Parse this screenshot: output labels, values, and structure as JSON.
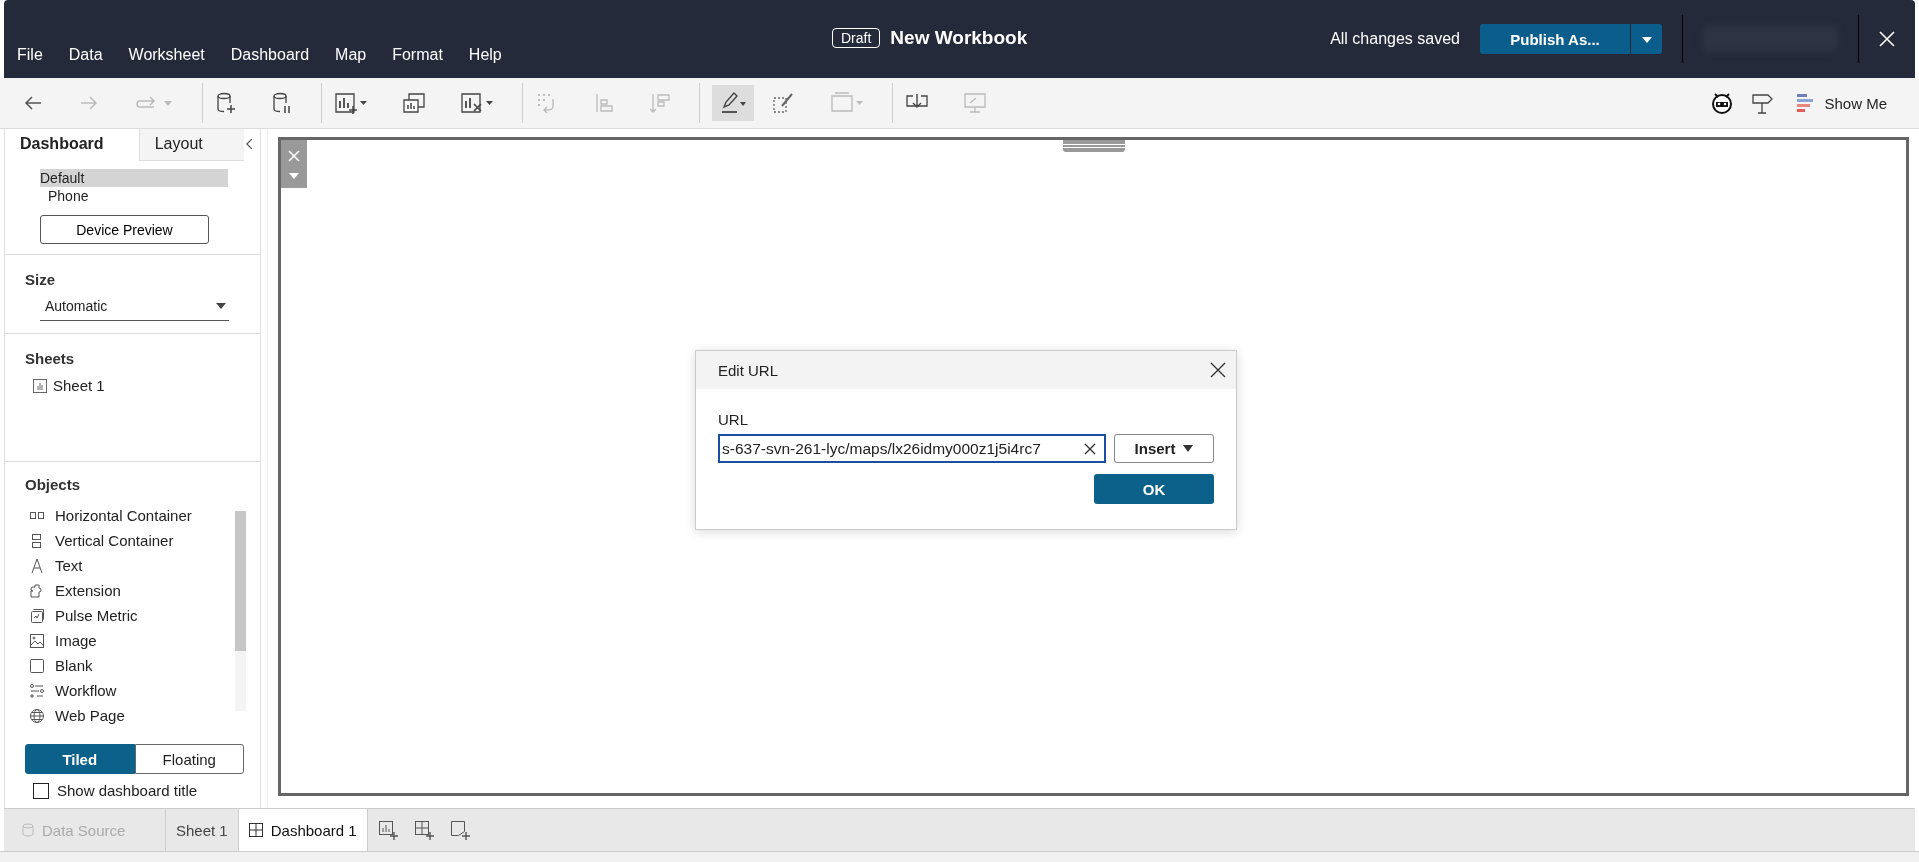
{
  "title_bar": {
    "badge": "Draft",
    "title": "New Workbook",
    "status": "All changes saved",
    "publish_button": "Publish As..."
  },
  "menu": [
    "File",
    "Data",
    "Worksheet",
    "Dashboard",
    "Map",
    "Format",
    "Help"
  ],
  "toolbar": {
    "show_me": "Show Me"
  },
  "side_panel": {
    "tabs": [
      {
        "label": "Dashboard",
        "selected": true
      },
      {
        "label": "Layout",
        "selected": false
      }
    ],
    "devices": [
      {
        "label": "Default",
        "selected": true
      },
      {
        "label": "Phone",
        "selected": false
      }
    ],
    "device_preview_button": "Device Preview",
    "size": {
      "heading": "Size",
      "value": "Automatic"
    },
    "sheets": {
      "heading": "Sheets",
      "items": [
        "Sheet 1"
      ]
    },
    "objects": {
      "heading": "Objects",
      "items": [
        {
          "label": "Horizontal Container",
          "kind": "hcontainer"
        },
        {
          "label": "Vertical Container",
          "kind": "vcontainer"
        },
        {
          "label": "Text",
          "kind": "text"
        },
        {
          "label": "Extension",
          "kind": "extension"
        },
        {
          "label": "Pulse Metric",
          "kind": "pulse"
        },
        {
          "label": "Image",
          "kind": "image"
        },
        {
          "label": "Blank",
          "kind": "blank"
        },
        {
          "label": "Workflow",
          "kind": "workflow"
        },
        {
          "label": "Web Page",
          "kind": "webpage"
        }
      ]
    },
    "layout_mode": [
      {
        "label": "Tiled",
        "selected": true
      },
      {
        "label": "Floating",
        "selected": false
      }
    ],
    "show_title": {
      "label": "Show dashboard title",
      "checked": false
    }
  },
  "sheet_tabs": [
    {
      "label": "Data Source",
      "kind": "datasource",
      "selected": false,
      "disabled": true
    },
    {
      "label": "Sheet 1",
      "kind": "worksheet",
      "selected": false,
      "disabled": false
    },
    {
      "label": "Dashboard 1",
      "kind": "dashboard",
      "selected": true,
      "disabled": false
    }
  ],
  "dialog": {
    "title": "Edit URL",
    "field_label": "URL",
    "value": "s-637-svn-261-lyc/maps/lx26idmy000z1j5i4rc7",
    "insert_button": "Insert",
    "ok_button": "OK"
  }
}
